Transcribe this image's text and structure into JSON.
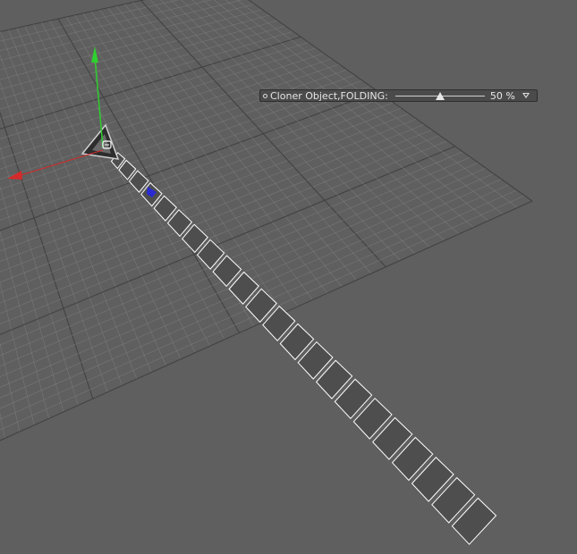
{
  "viewport": {
    "background_color": "#5f5f5f",
    "grid_color": "#8a8a8a"
  },
  "hud": {
    "label": "Cloner Object,FOLDING:",
    "value_label": "50 %",
    "slider_value_percent": 50
  },
  "axis_gizmo": {
    "x_axis_color": "#d42a2a",
    "y_axis_color": "#2fcf2f",
    "z_axis_color": "#2a2ad4"
  },
  "cloner": {
    "clone_count": 22,
    "tile_color": "#4e4e4e",
    "edge_color": "#ffffff"
  }
}
